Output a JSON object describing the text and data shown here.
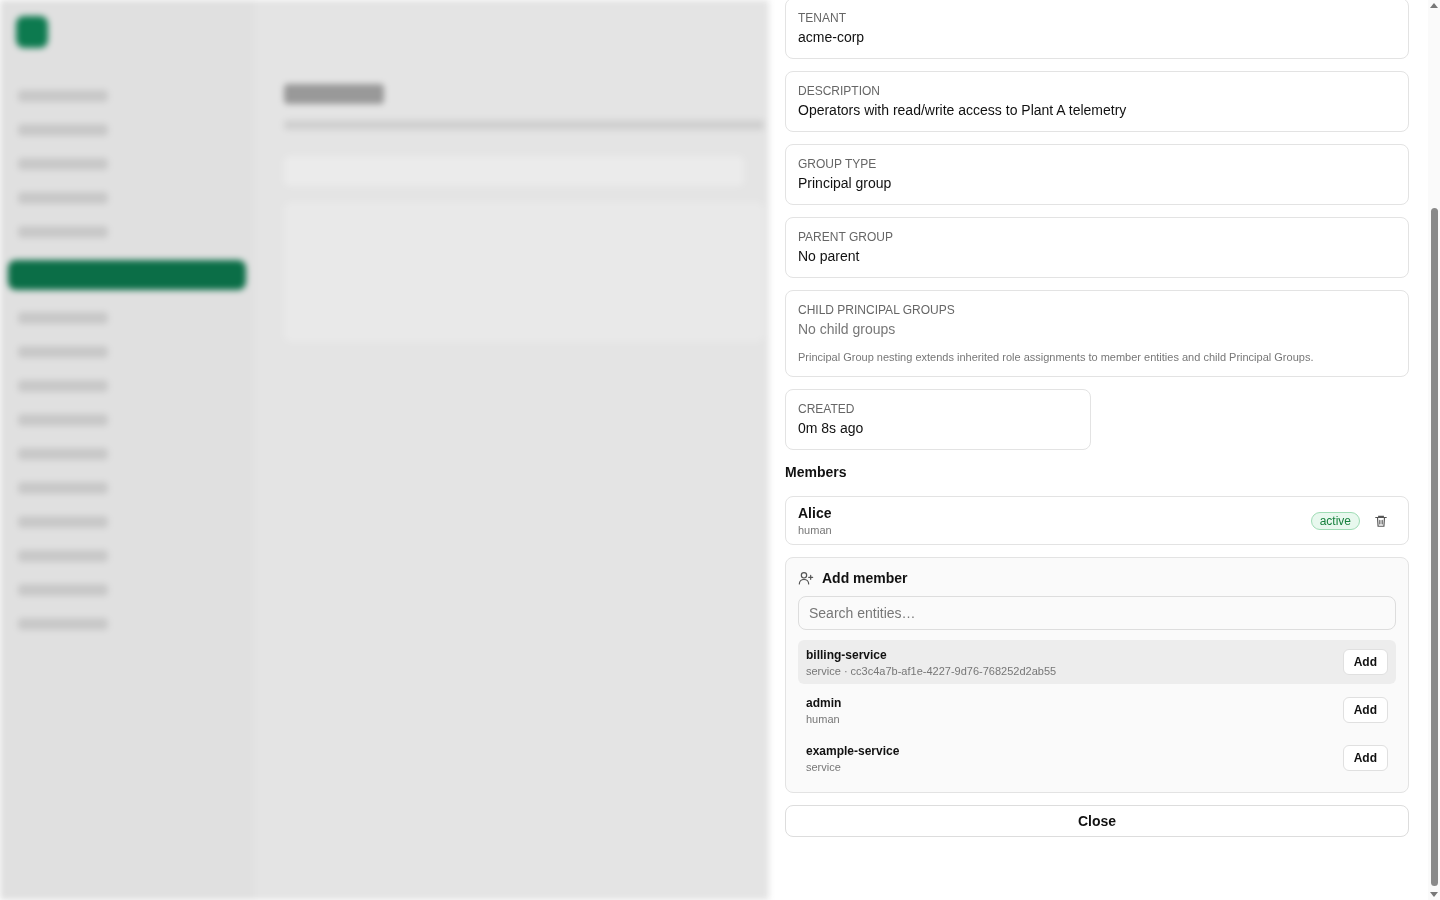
{
  "details": [
    {
      "label": "TENANT",
      "value": "acme-corp",
      "empty": false
    },
    {
      "label": "DESCRIPTION",
      "value": "Operators with read/write access to Plant A telemetry",
      "empty": false
    },
    {
      "label": "GROUP TYPE",
      "value": "Principal group",
      "empty": false
    },
    {
      "label": "PARENT GROUP",
      "value": "No parent",
      "empty": false
    },
    {
      "label": "CHILD PRINCIPAL GROUPS",
      "value": "No child groups",
      "empty": true,
      "note": "Principal Group nesting extends inherited role assignments to member entities and child Principal Groups."
    }
  ],
  "created": {
    "label": "CREATED",
    "value": "0m 8s ago"
  },
  "members": {
    "title": "Members",
    "items": [
      {
        "name": "Alice",
        "type": "human",
        "status": "active"
      }
    ]
  },
  "add_member": {
    "title": "Add member",
    "search": {
      "placeholder": "Search entities…"
    },
    "candidates": [
      {
        "name": "billing-service",
        "meta": "service · cc3c4a7b-af1e-4227-9d76-768252d2ab55",
        "highlighted": true,
        "button": "Add"
      },
      {
        "name": "admin",
        "meta": "human",
        "highlighted": false,
        "button": "Add"
      },
      {
        "name": "example-service",
        "meta": "service",
        "highlighted": false,
        "button": "Add"
      }
    ]
  },
  "close_button": "Close"
}
